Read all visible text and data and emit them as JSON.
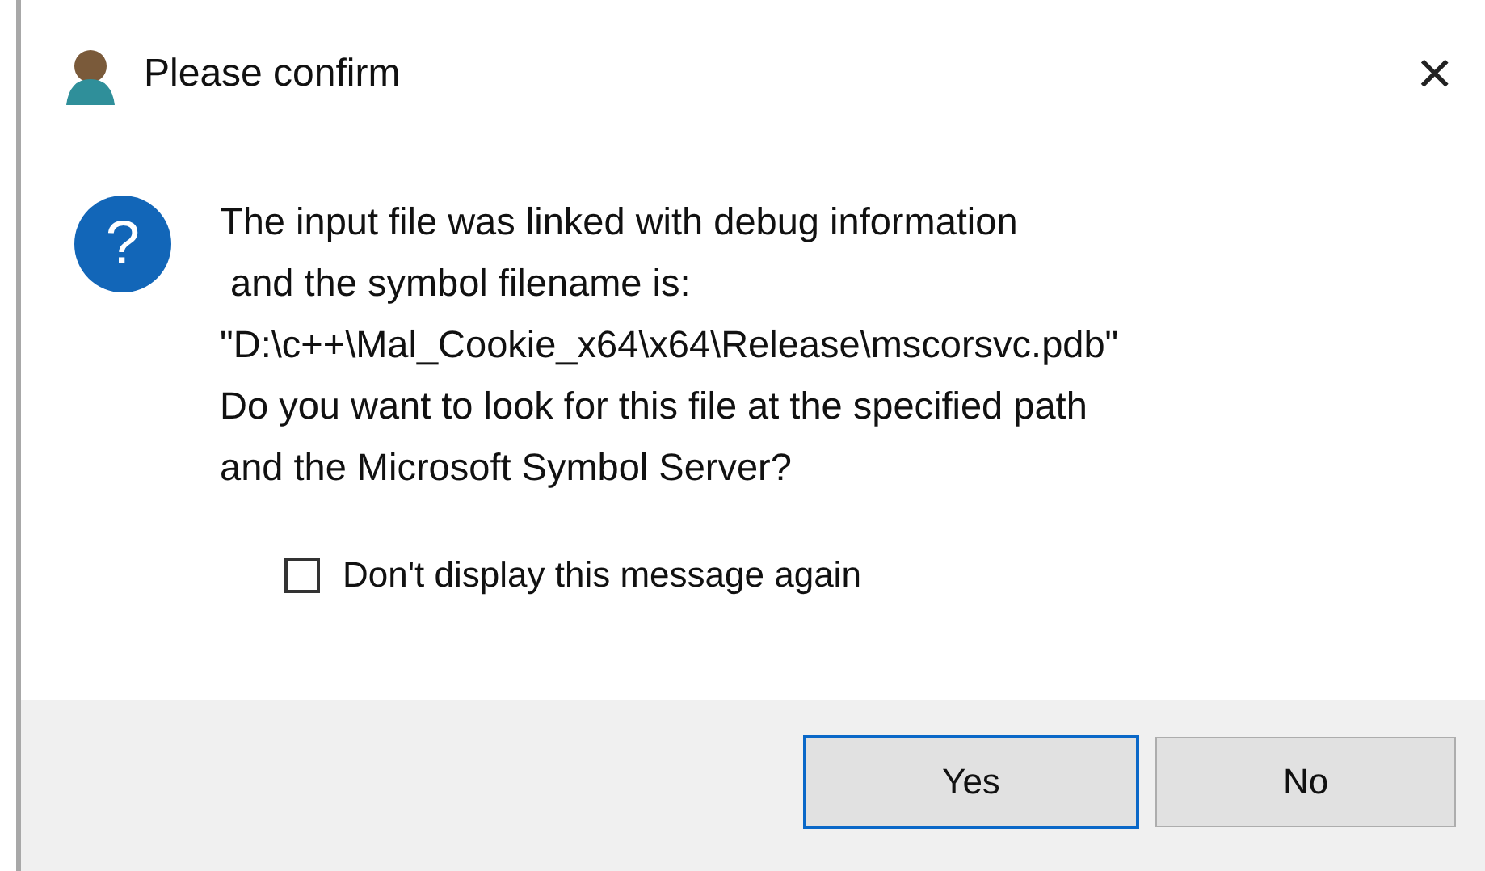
{
  "window": {
    "title": "Please confirm",
    "close": "×"
  },
  "message": {
    "icon": "?",
    "text": "The input file was linked with debug information\n and the symbol filename is:\n\"D:\\c++\\Mal_Cookie_x64\\x64\\Release\\mscorsvc.pdb\"\nDo you want to look for this file at the specified path\nand the Microsoft Symbol Server?"
  },
  "checkbox": {
    "label": "Don't display this message again",
    "checked": false
  },
  "buttons": [
    {
      "label": "Yes",
      "selected": true
    },
    {
      "label": "No",
      "selected": false
    }
  ]
}
